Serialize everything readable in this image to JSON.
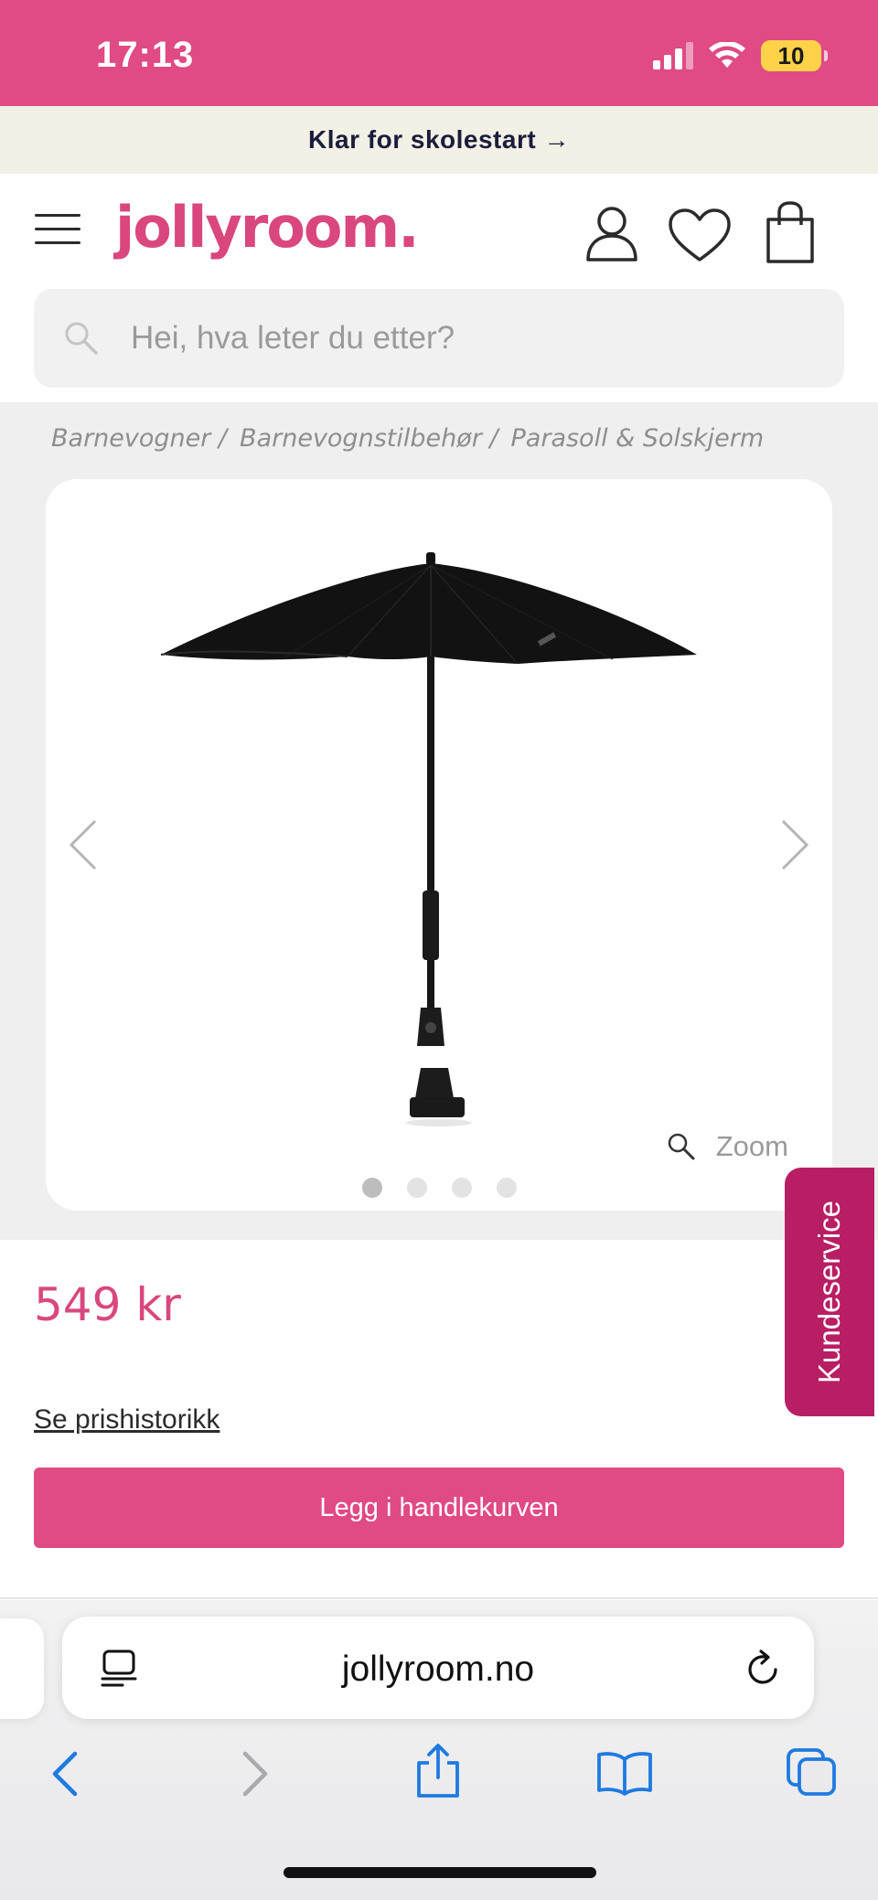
{
  "status_bar": {
    "time": "17:13",
    "battery": "10",
    "background": "#e04a85"
  },
  "promo_banner": {
    "text": "Klar for skolestart →"
  },
  "header": {
    "logo": "jollyroom.",
    "brand_color": "#d9477e",
    "icons": [
      "menu-icon",
      "account-icon",
      "heart-icon",
      "cart-icon"
    ]
  },
  "search": {
    "placeholder": "Hei, hva leter du etter?"
  },
  "breadcrumb": [
    "Barnevogner /",
    "Barnevognstilbehør /",
    "Parasoll & Solskjerm"
  ],
  "gallery": {
    "zoom_label": "Zoom",
    "slide_count": 4,
    "active_slide": 1
  },
  "product": {
    "price": "549 kr",
    "price_history_link": "Se prishistorikk",
    "add_to_cart_label": "Legg i handlekurven"
  },
  "kundeservice": {
    "label": "Kundeservice",
    "color": "#b81e64"
  },
  "browser": {
    "url": "jollyroom.no",
    "accent": "#1f7ae0"
  }
}
